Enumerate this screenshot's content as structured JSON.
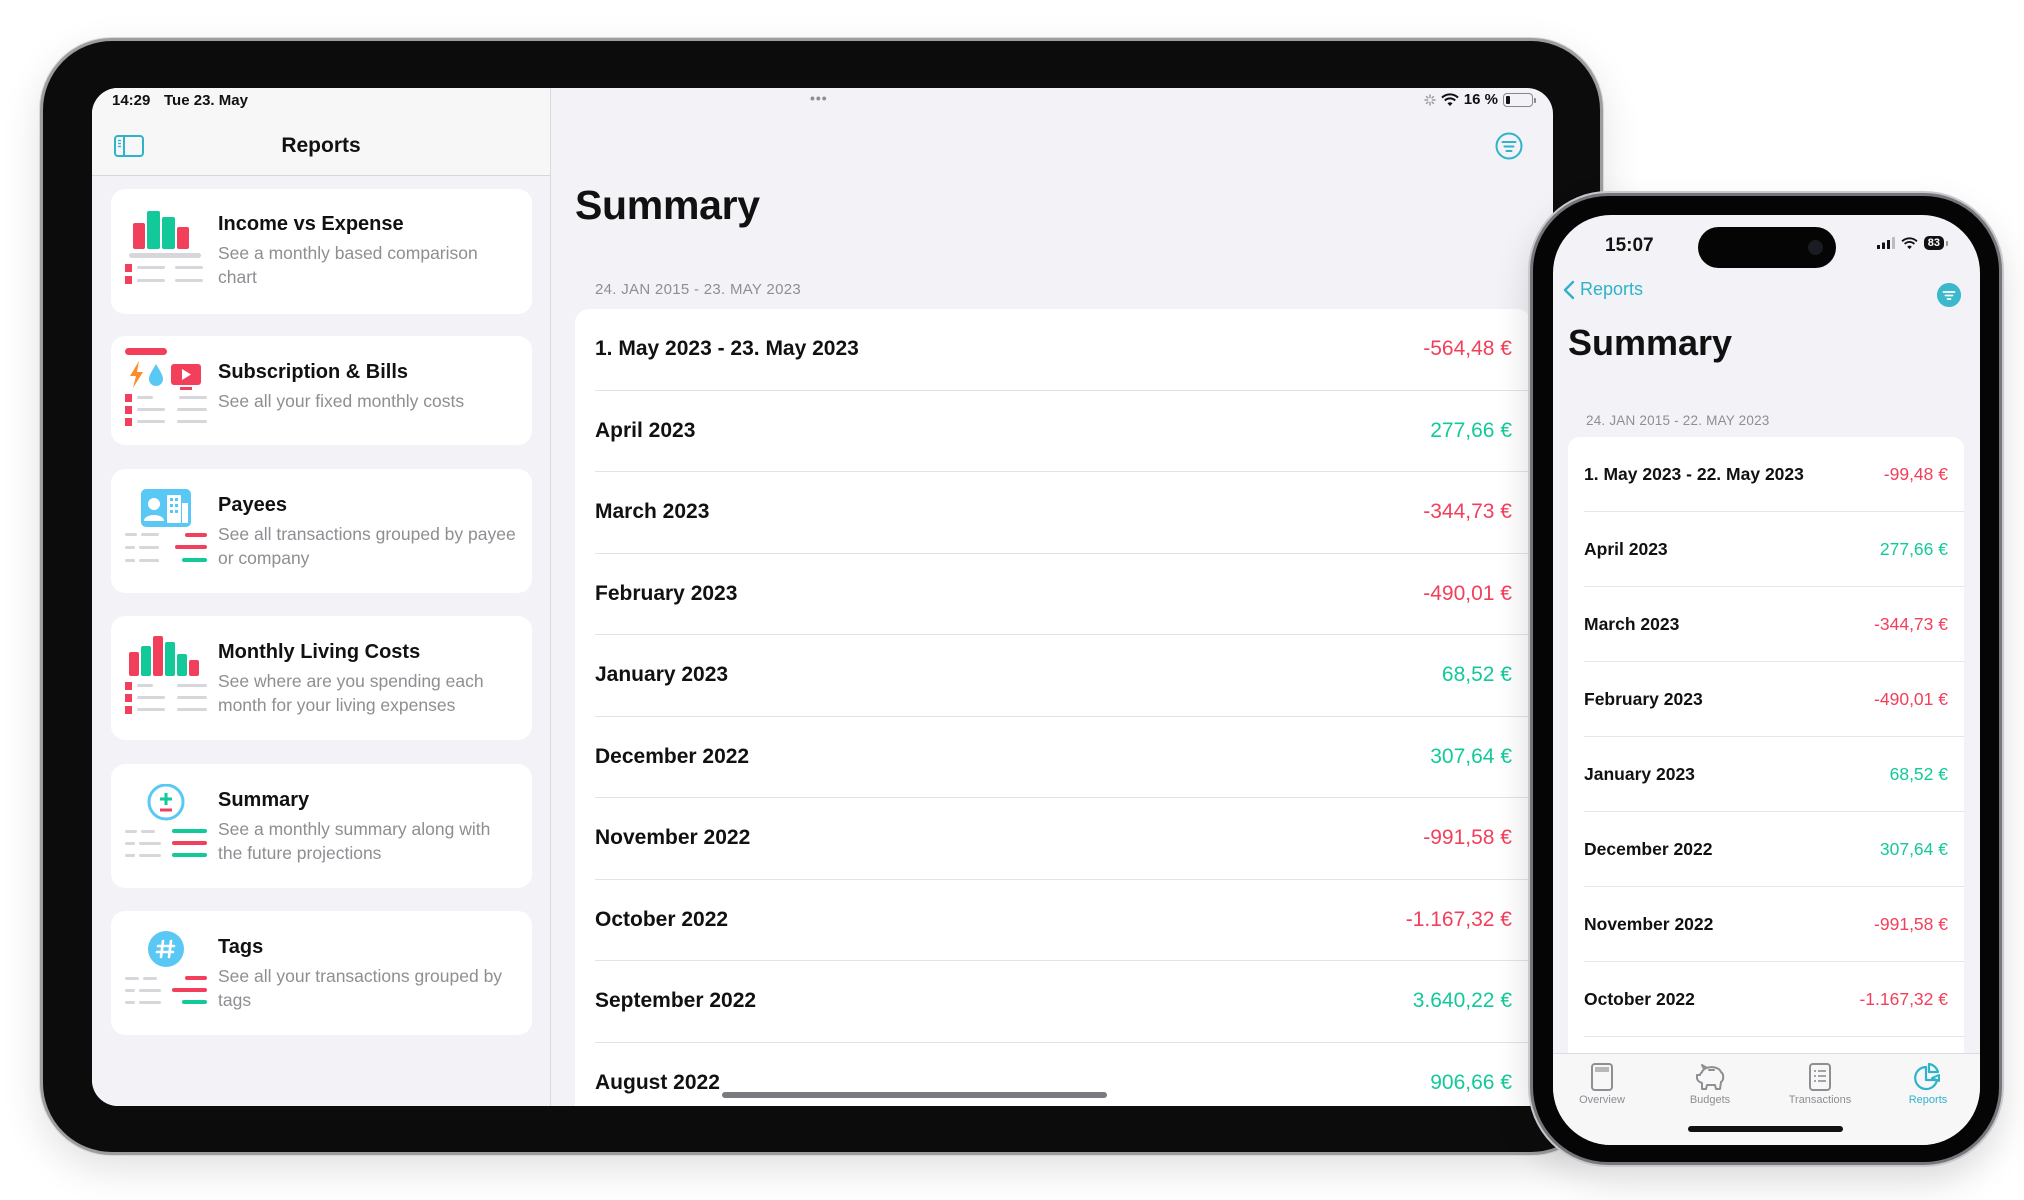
{
  "colors": {
    "accent": "#2fb3c9",
    "negative": "#f23f5b",
    "positive": "#13c99a",
    "secondary_text": "#8e8e93",
    "background": "#f2f2f7"
  },
  "ipad": {
    "status_bar": {
      "time": "14:29",
      "date": "Tue 23. May",
      "multitask_dots": "•••",
      "battery_text": "16 %",
      "battery_level": 0.16
    },
    "sidebar": {
      "toggle_icon": "sidebar-toggle-icon",
      "title": "Reports",
      "items": [
        {
          "title": "Income vs Expense",
          "description": "See a monthly based comparison chart",
          "icon": "bar-chart-icon"
        },
        {
          "title": "Subscription & Bills",
          "description": "See all your fixed monthly costs",
          "icon": "bills-icon"
        },
        {
          "title": "Payees",
          "description": "See all transactions grouped by payee or company",
          "icon": "payee-icon"
        },
        {
          "title": "Monthly Living Costs",
          "description": "See where are you spending each month for your living expenses",
          "icon": "living-costs-chart-icon"
        },
        {
          "title": "Summary",
          "description": "See a monthly summary along with the future projections",
          "icon": "plus-minus-icon"
        },
        {
          "title": "Tags",
          "description": "See all your transactions grouped by tags",
          "icon": "hashtag-icon"
        }
      ]
    },
    "detail": {
      "filter_icon": "filter-icon",
      "title": "Summary",
      "range": "24. JAN 2015 - 23. MAY 2023",
      "rows": [
        {
          "label": "1. May 2023 - 23. May 2023",
          "amount": "-564,48 €",
          "sign": "neg"
        },
        {
          "label": "April 2023",
          "amount": "277,66 €",
          "sign": "pos"
        },
        {
          "label": "March 2023",
          "amount": "-344,73 €",
          "sign": "neg"
        },
        {
          "label": "February 2023",
          "amount": "-490,01 €",
          "sign": "neg"
        },
        {
          "label": "January 2023",
          "amount": "68,52 €",
          "sign": "pos"
        },
        {
          "label": "December 2022",
          "amount": "307,64 €",
          "sign": "pos"
        },
        {
          "label": "November 2022",
          "amount": "-991,58 €",
          "sign": "neg"
        },
        {
          "label": "October 2022",
          "amount": "-1.167,32 €",
          "sign": "neg"
        },
        {
          "label": "September 2022",
          "amount": "3.640,22 €",
          "sign": "pos"
        },
        {
          "label": "August 2022",
          "amount": "906,66 €",
          "sign": "pos"
        }
      ]
    }
  },
  "iphone": {
    "status_bar": {
      "time": "15:07",
      "battery_text": "83"
    },
    "nav": {
      "back_label": "Reports",
      "filter_icon": "filter-icon"
    },
    "title": "Summary",
    "range": "24. JAN 2015 - 22. MAY 2023",
    "rows": [
      {
        "label": "1. May 2023 - 22. May 2023",
        "amount": "-99,48 €",
        "sign": "neg"
      },
      {
        "label": "April 2023",
        "amount": "277,66 €",
        "sign": "pos"
      },
      {
        "label": "March 2023",
        "amount": "-344,73 €",
        "sign": "neg"
      },
      {
        "label": "February 2023",
        "amount": "-490,01 €",
        "sign": "neg"
      },
      {
        "label": "January 2023",
        "amount": "68,52 €",
        "sign": "pos"
      },
      {
        "label": "December 2022",
        "amount": "307,64 €",
        "sign": "pos"
      },
      {
        "label": "November 2022",
        "amount": "-991,58 €",
        "sign": "neg"
      },
      {
        "label": "October 2022",
        "amount": "-1.167,32 €",
        "sign": "neg"
      }
    ],
    "tabbar": [
      {
        "label": "Overview",
        "icon": "overview-icon",
        "active": false
      },
      {
        "label": "Budgets",
        "icon": "piggy-bank-icon",
        "active": false
      },
      {
        "label": "Transactions",
        "icon": "transactions-list-icon",
        "active": false
      },
      {
        "label": "Reports",
        "icon": "reports-pie-icon",
        "active": true
      }
    ]
  }
}
